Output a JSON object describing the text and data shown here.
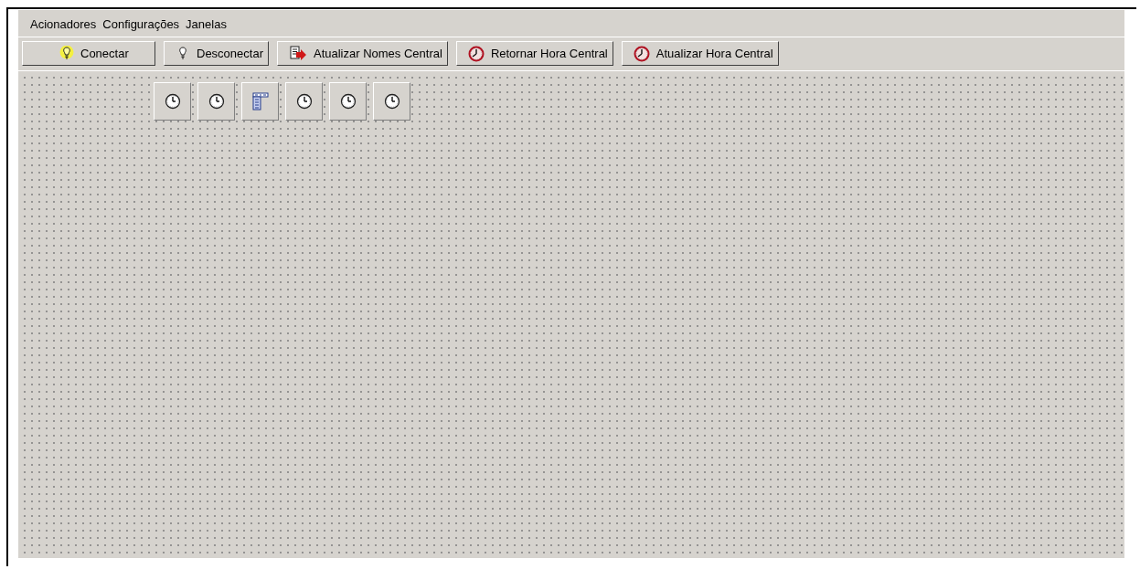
{
  "menu": [
    {
      "label": "Acionadores"
    },
    {
      "label": "Configurações"
    },
    {
      "label": "Janelas"
    }
  ],
  "toolbar": [
    {
      "label": "Conectar",
      "kind": "bulb-lit"
    },
    {
      "label": "Desconectar",
      "kind": "bulb"
    },
    {
      "label": "Atualizar Nomes Central",
      "kind": "document-arrow"
    },
    {
      "label": "Retornar Hora Central",
      "kind": "clock-red"
    },
    {
      "label": "Atualizar Hora Central",
      "kind": "clock-red"
    }
  ],
  "canvas_items": [
    {
      "kind": "clock"
    },
    {
      "kind": "clock"
    },
    {
      "kind": "list"
    },
    {
      "kind": "clock"
    },
    {
      "kind": "clock"
    },
    {
      "kind": "clock"
    }
  ]
}
